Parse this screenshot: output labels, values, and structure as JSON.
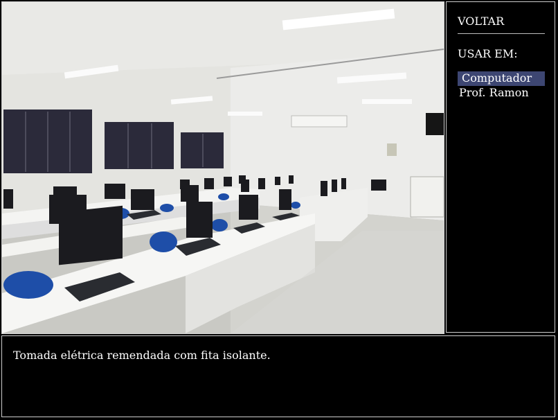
{
  "menu": {
    "back_label": "VOLTAR",
    "heading": "USAR EM:",
    "options": [
      {
        "label": "Computador",
        "selected": true
      },
      {
        "label": "Prof. Ramon",
        "selected": false
      }
    ]
  },
  "dialog": {
    "text": "Tomada elétrica remendada com fita isolante."
  },
  "colors": {
    "selection": "#3d4672",
    "panel_border": "#cfcfcf",
    "background": "#000000"
  }
}
